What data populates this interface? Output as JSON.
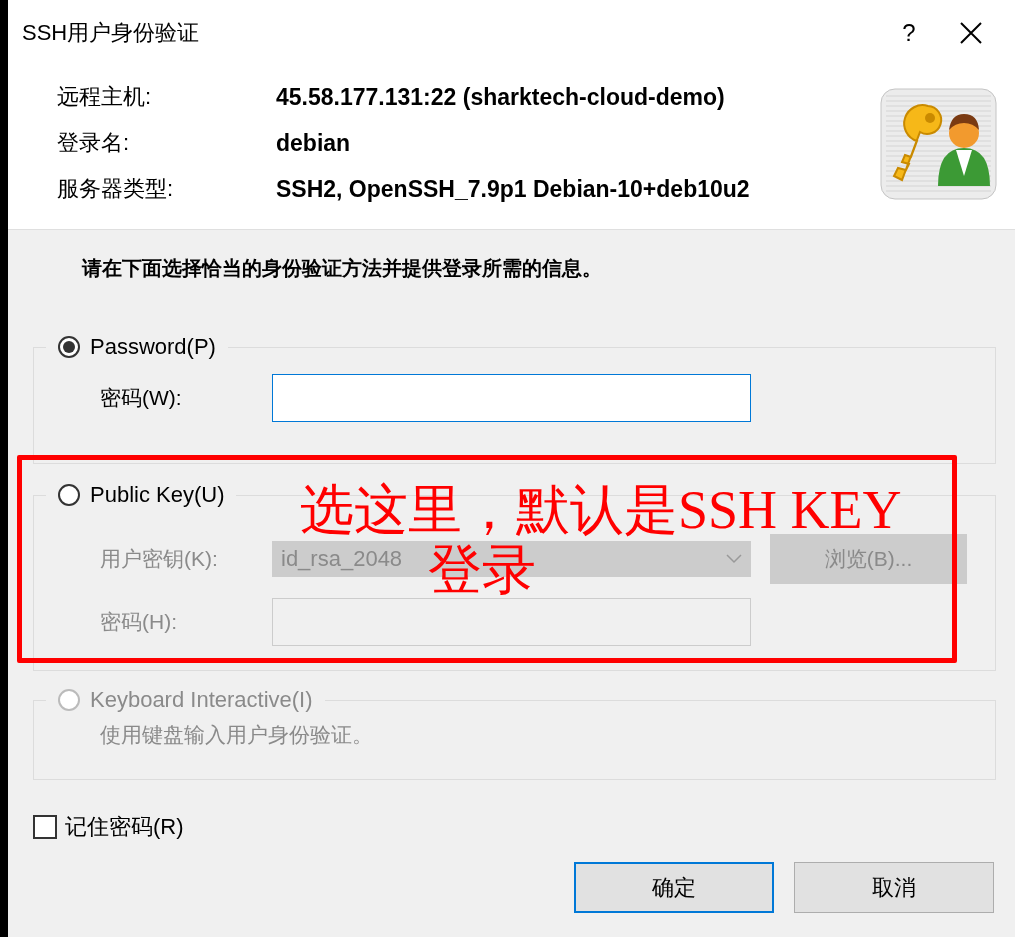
{
  "window": {
    "title": "SSH用户身份验证",
    "help": "?"
  },
  "host_info": [
    {
      "label": "远程主机:",
      "value": "45.58.177.131:22 (sharktech-cloud-demo)"
    },
    {
      "label": "登录名:",
      "value": "debian"
    },
    {
      "label": "服务器类型:",
      "value": "SSH2, OpenSSH_7.9p1 Debian-10+deb10u2"
    }
  ],
  "instruction": "请在下面选择恰当的身份验证方法并提供登录所需的信息。",
  "methods": [
    {
      "kind": "password",
      "label": "Password(P)",
      "selected": true,
      "disabled": false,
      "fields": [
        {
          "kind": "input",
          "label": "密码(W):",
          "disabled": false,
          "focused": true
        }
      ]
    },
    {
      "kind": "publickey",
      "label": "Public Key(U)",
      "selected": false,
      "disabled": false,
      "fields": [
        {
          "kind": "select",
          "label": "用户密钥(K):",
          "value": "id_rsa_2048",
          "disabled": true,
          "button": "浏览(B)..."
        },
        {
          "kind": "input",
          "label": "密码(H):",
          "disabled": true
        }
      ]
    },
    {
      "kind": "keyboard",
      "label": "Keyboard Interactive(I)",
      "selected": false,
      "disabled": true,
      "description": "使用键盘输入用户身份验证。"
    }
  ],
  "remember": {
    "label": "记住密码(R)",
    "checked": false
  },
  "buttons": [
    {
      "label": "确定",
      "default": true
    },
    {
      "label": "取消",
      "default": false
    }
  ],
  "annotation": {
    "lines": [
      "选这里，默认是SSH KEY",
      "登录"
    ]
  }
}
